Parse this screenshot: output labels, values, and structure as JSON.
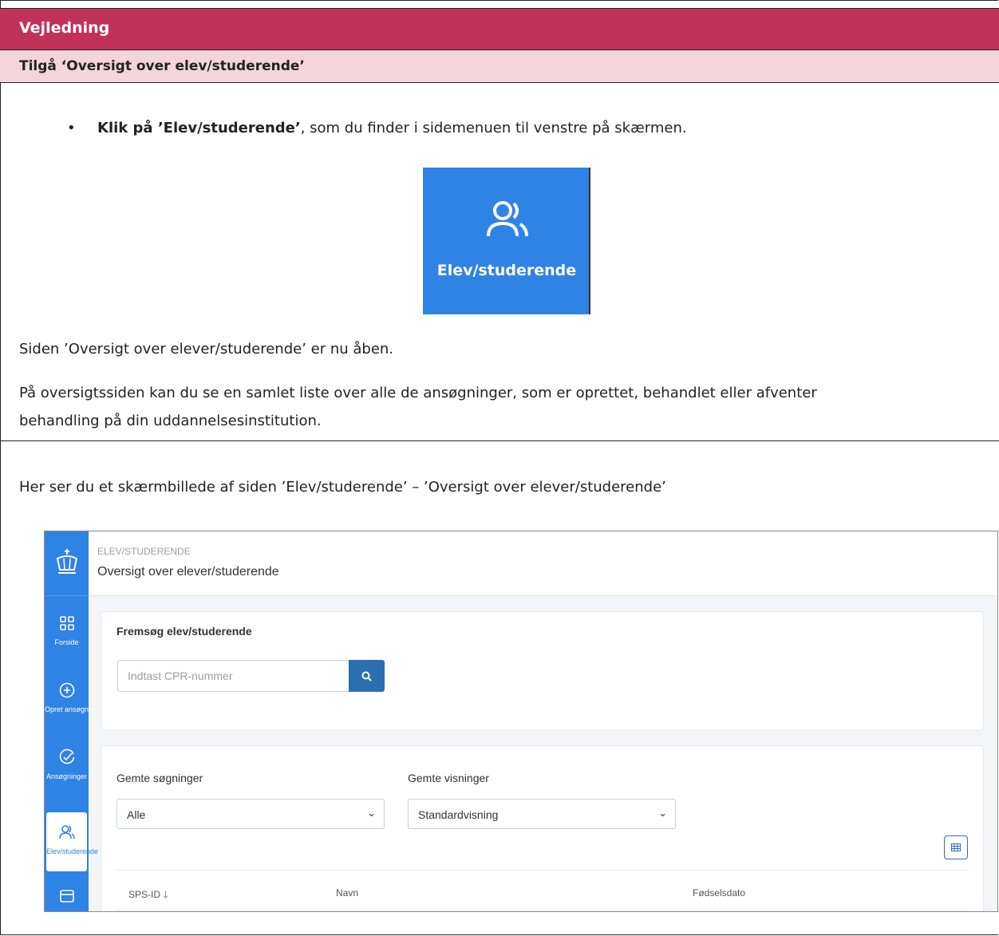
{
  "header": {
    "title": "Vejledning"
  },
  "subheader": {
    "title": "Tilgå ‘Oversigt over elev/studerende’"
  },
  "bullet": {
    "marker": "•",
    "bold": "Klik på ’Elev/studerende’",
    "rest": ", som du finder i sidemenuen til venstre på skærmen."
  },
  "tile": {
    "label": "Elev/studerende",
    "icon": "users-icon",
    "color": "#2f83e4"
  },
  "paragraphs": {
    "p1": "Siden ’Oversigt over elever/studerende’ er nu åben.",
    "p2a": "På oversigtssiden kan du se en samlet liste over alle de ansøgninger, som er oprettet, behandlet eller afventer",
    "p2b": "behandling på din uddannelsesinstitution.",
    "p3": "Her ser du et skærmbillede af siden ’Elev/studerende’ – ’Oversigt over elever/studerende’"
  },
  "screenshot": {
    "sidebar": {
      "logo": "crown-icon",
      "items": [
        {
          "label": "Forside",
          "icon": "grid-icon"
        },
        {
          "label": "Opret ansøgning",
          "icon": "plus-circle-icon"
        },
        {
          "label": "Ansøgninger",
          "icon": "check-circle-icon"
        },
        {
          "label": "Elev/studerende",
          "icon": "users-icon",
          "active": true
        },
        {
          "label": "",
          "icon": "card-icon"
        }
      ]
    },
    "breadcrumb": "ELEV/STUDERENDE",
    "page_title": "Oversigt over elever/studerende",
    "search_card": {
      "title": "Fremsøg elev/studerende",
      "placeholder": "Indtast CPR-nummer",
      "button_icon": "search-icon"
    },
    "filters": {
      "saved_searches_label": "Gemte søgninger",
      "saved_searches_value": "Alle",
      "saved_views_label": "Gemte visninger",
      "saved_views_value": "Standardvisning",
      "table_settings_icon": "table-icon"
    },
    "table": {
      "columns": [
        "SPS-ID",
        "Navn",
        "Fødselsdato"
      ],
      "sort_icon": "arrow-down-icon"
    }
  },
  "colors": {
    "header": "#c0325a",
    "subheader": "#f4d4dd",
    "accent": "#2f83e4"
  }
}
